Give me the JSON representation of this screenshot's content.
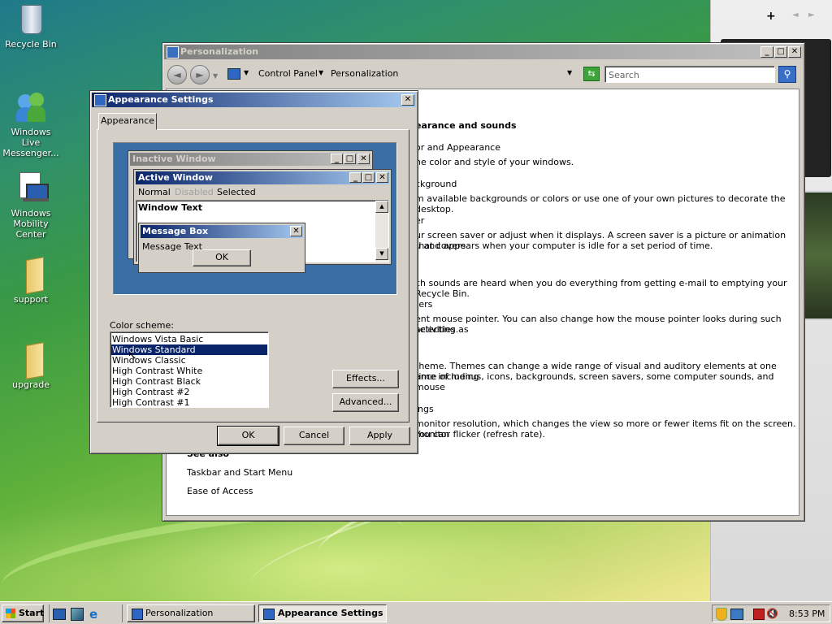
{
  "desktop": {
    "icons": [
      {
        "label": "Recycle Bin"
      },
      {
        "label": "Windows Live Messenger..."
      },
      {
        "label": "Windows Mobility Center"
      },
      {
        "label": "support"
      },
      {
        "label": "upgrade"
      }
    ]
  },
  "sidebar": {
    "plus": "+",
    "prev": "◄",
    "next": "►"
  },
  "personalization": {
    "title": "Personalization",
    "breadcrumb": [
      "Control Panel",
      "Personalization"
    ],
    "search_placeholder": "Search",
    "heading": "earance and sounds",
    "items": [
      {
        "link": "or and Appearance",
        "desc": "ne color and style of your windows."
      },
      {
        "link": "ckground",
        "desc": "m available backgrounds or colors or use one of your own pictures to decorate the desktop."
      },
      {
        "link": "er",
        "desc": "ur screen saver or adjust when it displays. A screen saver is a picture or animation that covers",
        "desc2": "u and appears when your computer is idle for a set period of time."
      },
      {
        "link": "",
        "desc": "ch sounds are heard when you do everything from getting e-mail to emptying your Recycle Bin."
      },
      {
        "link": "ters",
        "desc": "ent mouse pointer. You can also change how the mouse pointer looks during such activities as",
        "desc2": "selecting."
      },
      {
        "link": "",
        "desc": "theme. Themes can change a wide range of visual and auditory elements at one time including",
        "desc2": "ance of menus, icons, backgrounds, screen savers, some computer sounds, and mouse"
      },
      {
        "link": "ings",
        "desc": "monitor resolution, which changes the view so more or fewer items fit on the screen. You can",
        "desc2": "monitor flicker (refresh rate)."
      }
    ],
    "see_also": "See also",
    "see_also_links": [
      "Taskbar and Start Menu",
      "Ease of Access"
    ]
  },
  "appearance": {
    "title": "Appearance Settings",
    "tab": "Appearance",
    "preview": {
      "inactive_title": "Inactive Window",
      "active_title": "Active Window",
      "menu": [
        "Normal",
        "Disabled",
        "Selected"
      ],
      "window_text": "Window Text",
      "msgbox_title": "Message Box",
      "msgbox_text": "Message Text",
      "msgbox_ok": "OK"
    },
    "color_scheme_label": "Color scheme:",
    "schemes": [
      "Windows Vista Basic",
      "Windows Standard",
      "Windows Classic",
      "High Contrast White",
      "High Contrast Black",
      "High Contrast #2",
      "High Contrast #1"
    ],
    "selected_scheme": "Windows Standard",
    "effects": "Effects...",
    "advanced": "Advanced...",
    "ok": "OK",
    "cancel": "Cancel",
    "apply": "Apply"
  },
  "taskbar": {
    "start": "Start",
    "tasks": [
      "Personalization",
      "Appearance Settings"
    ],
    "clock": "8:53 PM"
  }
}
